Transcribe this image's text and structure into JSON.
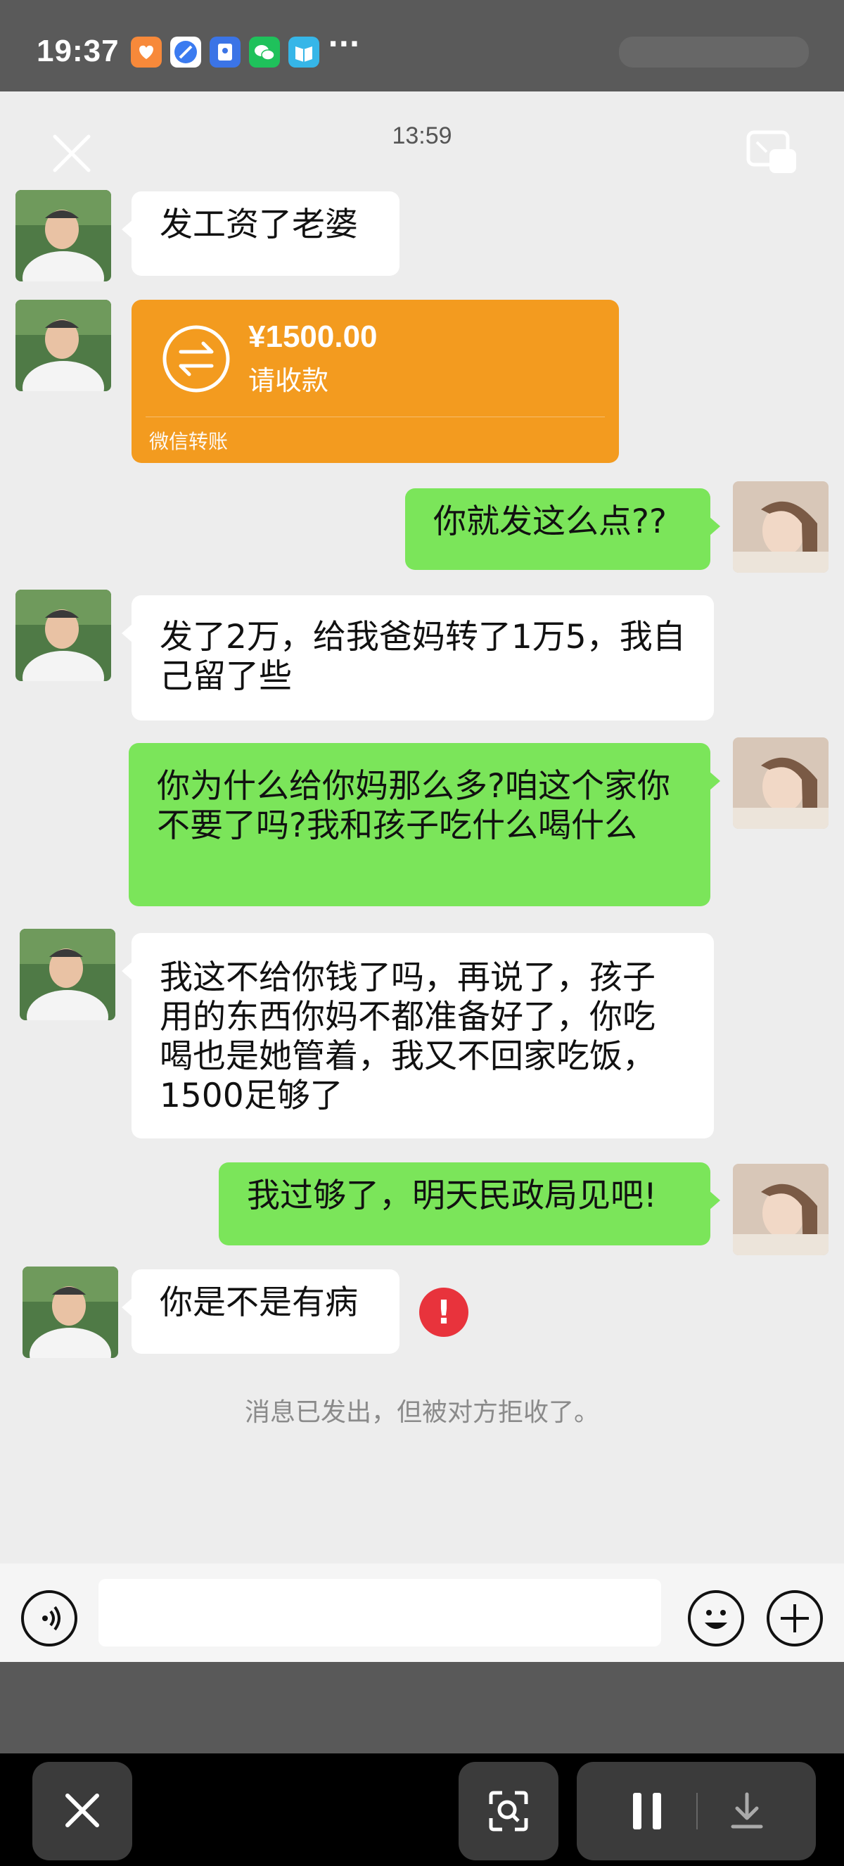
{
  "status_bar": {
    "time": "19:37",
    "more_label": "···",
    "icons": [
      "taobao-icon",
      "browser-icon",
      "app-store-icon",
      "wechat-icon",
      "reader-icon"
    ]
  },
  "chat": {
    "timestamp": "13:59",
    "messages": [
      {
        "side": "in",
        "text": "发工资了老婆"
      },
      {
        "side": "in",
        "type": "transfer"
      },
      {
        "side": "out",
        "text": "你就发这么点??"
      },
      {
        "side": "in",
        "text": "发了2万，给我爸妈转了1万5，我自己留了些"
      },
      {
        "side": "out",
        "text": "你为什么给你妈那么多?咱这个家你不要了吗?我和孩子吃什么喝什么"
      },
      {
        "side": "in",
        "text": "我这不给你钱了吗，再说了，孩子用的东西你妈不都准备好了，你吃喝也是她管着，我又不回家吃饭，1500足够了"
      },
      {
        "side": "out",
        "text": "我过够了，明天民政局见吧!"
      },
      {
        "side": "in",
        "text": "你是不是有病",
        "status": "rejected"
      }
    ],
    "transfer": {
      "amount": "¥1500.00",
      "subtitle": "请收款",
      "footer": "微信转账"
    },
    "rejected_icon": "!",
    "system_note": "消息已发出，但被对方拒收了。"
  },
  "colors": {
    "outgoing_bubble": "#7be55a",
    "incoming_bubble": "#ffffff",
    "transfer": "#f39b1f",
    "error": "#e8333c",
    "chat_bg": "#ededed"
  }
}
